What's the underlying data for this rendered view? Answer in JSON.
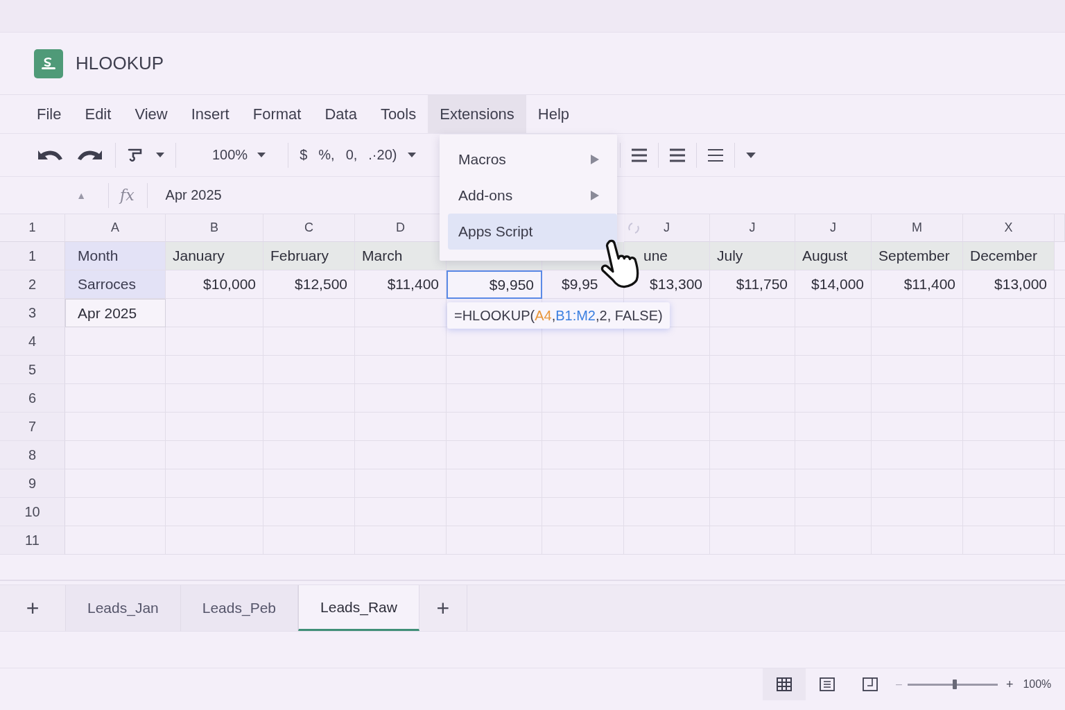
{
  "app": {
    "title": "HLOOKUP"
  },
  "menu_bar": [
    {
      "label": "File",
      "selected": false
    },
    {
      "label": "Edit",
      "selected": false
    },
    {
      "label": "View",
      "selected": false
    },
    {
      "label": "Insert",
      "selected": false
    },
    {
      "label": "Format",
      "selected": false
    },
    {
      "label": "Data",
      "selected": false
    },
    {
      "label": "Tools",
      "selected": false
    },
    {
      "label": "Extensions",
      "selected": true
    },
    {
      "label": "Help",
      "selected": false
    }
  ],
  "toolbar": {
    "zoom": "100%",
    "formats": [
      "$",
      "%,",
      "0,",
      ".·20)"
    ]
  },
  "formula_bar": {
    "name_box": "▲",
    "fx": "fx",
    "value": "Apr 2025"
  },
  "sheet": {
    "corner": "1",
    "columns": [
      {
        "label": "A"
      },
      {
        "label": "B"
      },
      {
        "label": "C"
      },
      {
        "label": "D"
      },
      {},
      {},
      {
        "label": "J",
        "kind": "sync"
      },
      {
        "label": "J"
      },
      {
        "label": "J"
      },
      {
        "label": "M"
      },
      {
        "label": "X"
      }
    ],
    "rows": [
      {
        "number": "1",
        "cells": [
          {
            "text": "Month",
            "kind": "label",
            "selected": false
          },
          {
            "text": "January",
            "kind": "header",
            "selected": false
          },
          {
            "text": "February",
            "kind": "header",
            "selected": false
          },
          {
            "text": "March",
            "kind": "header",
            "selected": false
          },
          {
            "kind": "header"
          },
          {
            "kind": "header"
          },
          {
            "text": "une",
            "kind": "header-cut",
            "selected": false
          },
          {
            "text": "July",
            "kind": "header",
            "selected": false
          },
          {
            "text": "August",
            "kind": "header",
            "selected": false
          },
          {
            "text": "September",
            "kind": "header",
            "selected": false
          },
          {
            "text": "December",
            "kind": "header",
            "selected": false
          }
        ]
      },
      {
        "number": "2",
        "cells": [
          {
            "text": "Sarroces",
            "kind": "label",
            "selected": false
          },
          {
            "text": "$10,000",
            "kind": "value",
            "selected": false
          },
          {
            "text": "$12,500",
            "kind": "value",
            "selected": false
          },
          {
            "text": "$11,400",
            "kind": "value",
            "selected": false
          },
          {
            "text": "$9,950",
            "kind": "value",
            "selected": true
          },
          {
            "text": "$9,95",
            "kind": "value-cut",
            "selected": false
          },
          {
            "text": "$13,300",
            "kind": "value",
            "selected": false
          },
          {
            "text": "$11,750",
            "kind": "value",
            "selected": false
          },
          {
            "text": "$14,000",
            "kind": "value",
            "selected": false
          },
          {
            "text": "$11,400",
            "kind": "value",
            "selected": false
          },
          {
            "text": "$13,000",
            "kind": "value",
            "selected": false
          }
        ]
      },
      {
        "number": "3",
        "cells": [
          {
            "text": "Apr 2025",
            "kind": "input",
            "selected": false
          }
        ]
      },
      {
        "number": "4"
      },
      {
        "number": "5"
      },
      {
        "number": "6"
      },
      {
        "number": "7"
      },
      {
        "number": "8"
      },
      {
        "number": "9"
      },
      {
        "number": "10"
      },
      {
        "number": "11"
      }
    ]
  },
  "dropdown": [
    {
      "label": "Macros",
      "submenu": true,
      "selected": false
    },
    {
      "label": "Add-ons",
      "submenu": true,
      "selected": false
    },
    {
      "label": "Apps Script",
      "submenu": false,
      "selected": true
    }
  ],
  "formula_tip": {
    "parts": [
      {
        "text": "=HLOOKUP("
      },
      {
        "text": "A4",
        "color": "#e8963a"
      },
      {
        "text": ", "
      },
      {
        "text": "B1:M2",
        "color": "#3b7fe0"
      },
      {
        "text": ",2, FALSE)"
      }
    ]
  },
  "sheet_tabs": {
    "add": "+",
    "tabs": [
      {
        "label": "Leads_Jan",
        "selected": false
      },
      {
        "label": "Leads_Peb",
        "selected": false
      },
      {
        "label": "Leads_Raw",
        "selected": true
      }
    ],
    "add_after": "+"
  },
  "status_bar": {
    "views": [
      {
        "kind": "grid",
        "selected": true
      },
      {
        "kind": "list",
        "selected": false
      },
      {
        "kind": "page",
        "selected": false
      }
    ],
    "zoom_minus": "–",
    "zoom": {
      "level": 0.52
    },
    "zoom_plus": "+",
    "zoom_label": "100%"
  }
}
